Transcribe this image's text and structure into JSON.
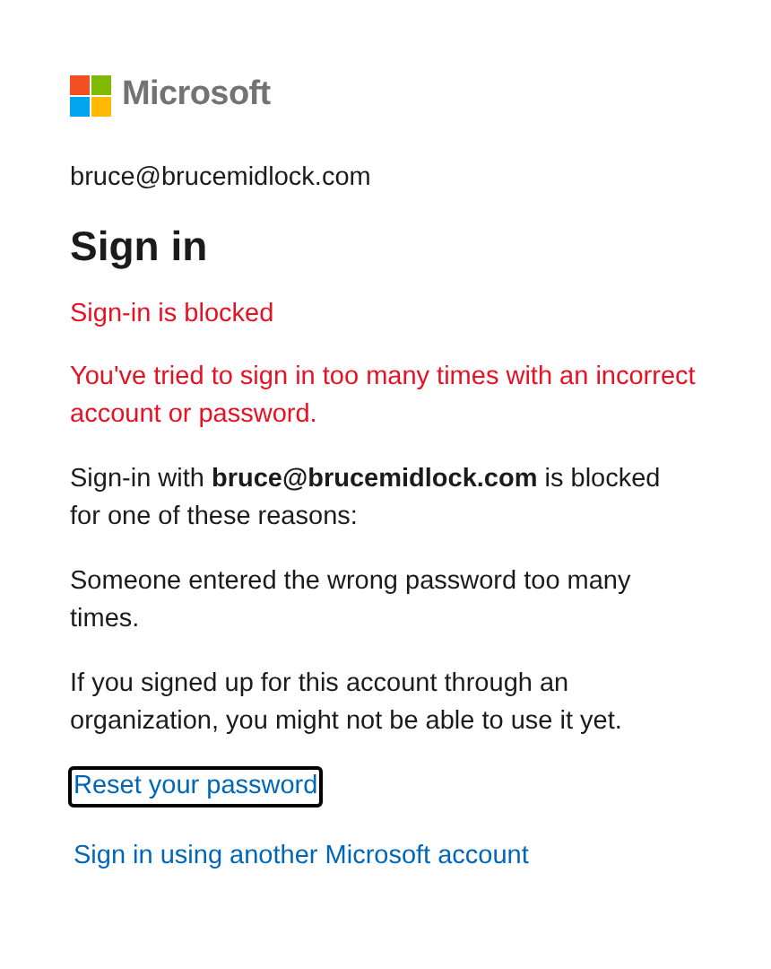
{
  "logo": {
    "text": "Microsoft"
  },
  "account": "bruce@brucemidlock.com",
  "title": "Sign in",
  "error_title": "Sign-in is blocked",
  "error_message": "You've tried to sign in too many times with an incorrect account or password.",
  "paragraphs": [
    "Sign-in with **bruce@brucemidlock.com** is blocked for one of these reasons:",
    "Someone entered the wrong password too many times.",
    "If you signed up for this account through an organization, you might not be able to use it yet."
  ],
  "links": [
    {
      "label": "Reset your password",
      "focused": true
    },
    {
      "label": "Sign in using another Microsoft account",
      "focused": false
    }
  ]
}
